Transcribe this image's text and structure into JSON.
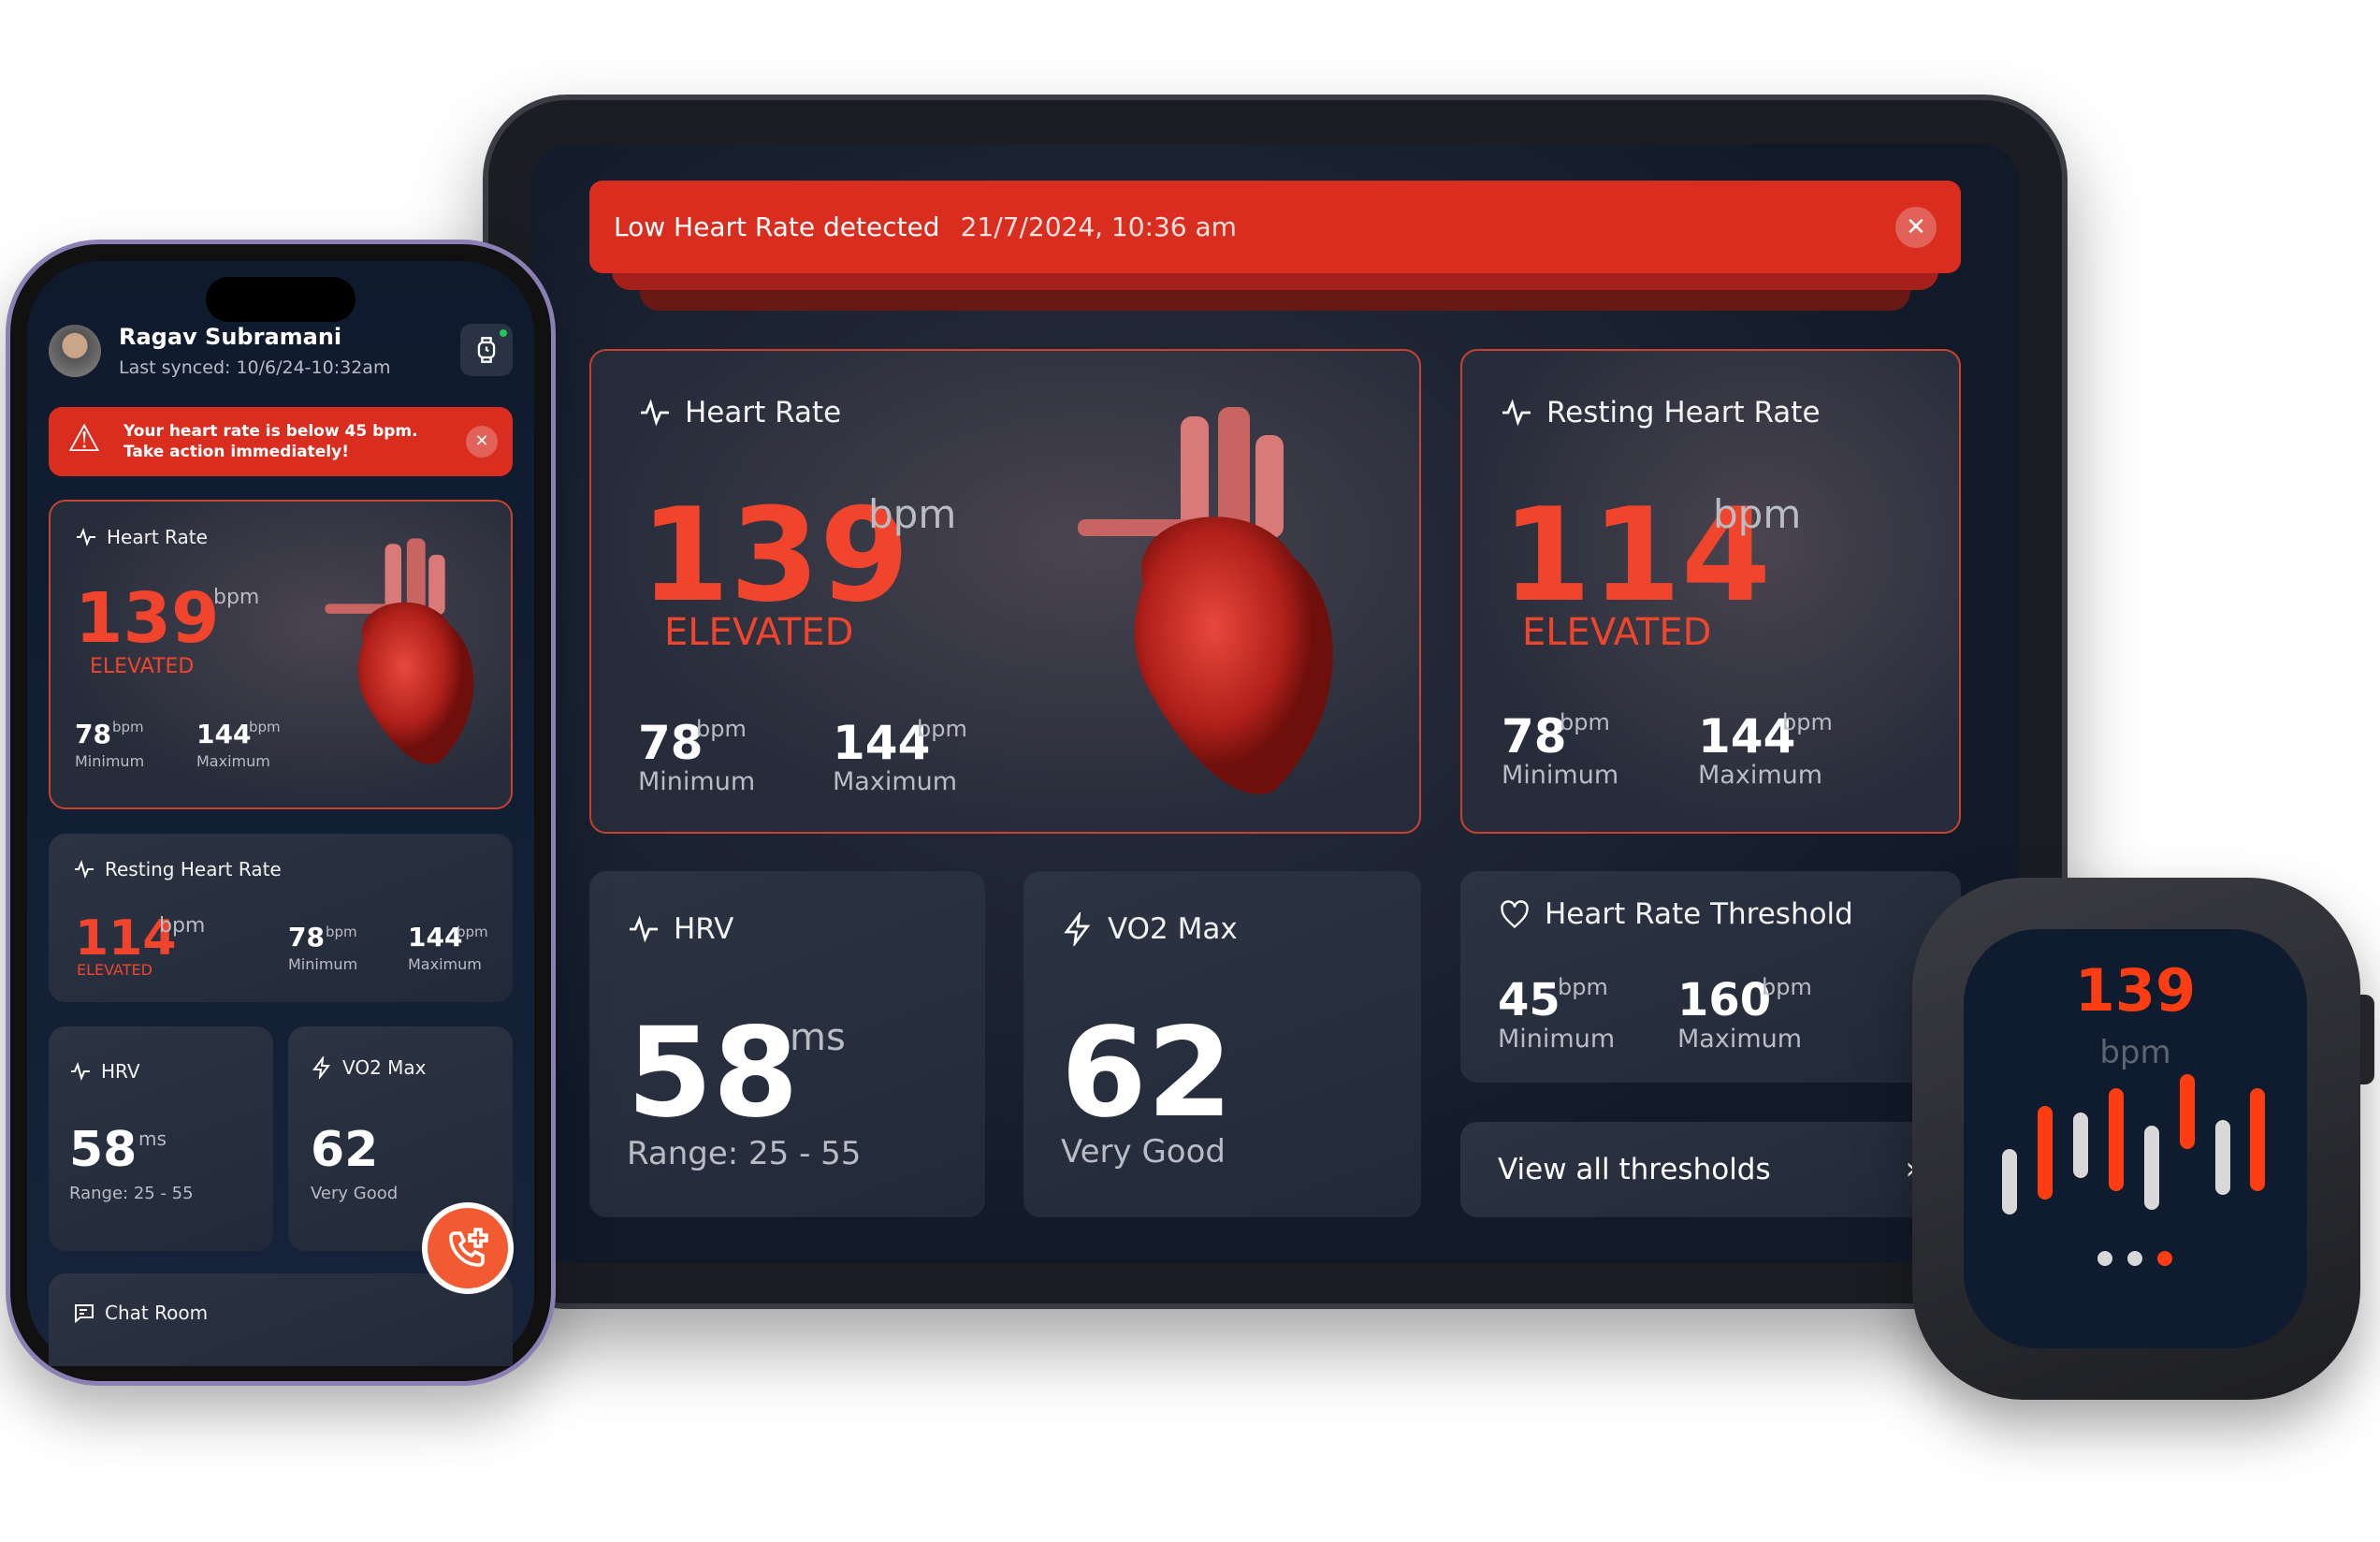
{
  "tablet": {
    "alert": {
      "title": "Low Heart Rate detected",
      "timestamp": "21/7/2024, 10:36 am",
      "close_icon": "close-icon"
    },
    "heart_rate": {
      "title": "Heart Rate",
      "value": "139",
      "unit": "bpm",
      "status": "ELEVATED",
      "min": "78",
      "min_unit": "bpm",
      "min_label": "Minimum",
      "max": "144",
      "max_unit": "bpm",
      "max_label": "Maximum"
    },
    "resting": {
      "title": "Resting Heart Rate",
      "value": "114",
      "unit": "bpm",
      "status": "ELEVATED",
      "min": "78",
      "min_unit": "bpm",
      "min_label": "Minimum",
      "max": "144",
      "max_unit": "bpm",
      "max_label": "Maximum"
    },
    "hrv": {
      "title": "HRV",
      "value": "58",
      "unit": "ms",
      "range": "Range: 25 - 55"
    },
    "vo2": {
      "title": "VO2 Max",
      "value": "62",
      "status": "Very Good"
    },
    "threshold": {
      "title": "Heart Rate Threshold",
      "min": "45",
      "min_unit": "bpm",
      "min_label": "Minimum",
      "max": "160",
      "max_unit": "bpm",
      "max_label": "Maximum"
    },
    "view_all": "View all thresholds"
  },
  "phone": {
    "user_name": "Ragav Subramani",
    "last_synced": "Last synced: 10/6/24-10:32am",
    "alert": "Your heart rate is below 45 bpm. Take action immediately!",
    "heart_rate": {
      "title": "Heart Rate",
      "value": "139",
      "unit": "bpm",
      "status": "ELEVATED",
      "min": "78",
      "min_unit": "bpm",
      "min_label": "Minimum",
      "max": "144",
      "max_unit": "bpm",
      "max_label": "Maximum"
    },
    "resting": {
      "title": "Resting Heart Rate",
      "value": "114",
      "unit": "bpm",
      "status": "ELEVATED",
      "min": "78",
      "min_unit": "bpm",
      "min_label": "Minimum",
      "max": "144",
      "max_unit": "bpm",
      "max_label": "Maximum"
    },
    "hrv": {
      "title": "HRV",
      "value": "58",
      "unit": "ms",
      "range": "Range: 25 - 55"
    },
    "vo2": {
      "title": "VO2 Max",
      "value": "62",
      "status": "Very Good"
    },
    "chat": "Chat Room"
  },
  "watch": {
    "value": "139",
    "unit": "bpm",
    "page_dots": 3,
    "active_page": 3
  },
  "colors": {
    "accent": "#f0452c",
    "alert": "#d92d20",
    "fab": "#f25a32",
    "bg": "#121a2a"
  }
}
